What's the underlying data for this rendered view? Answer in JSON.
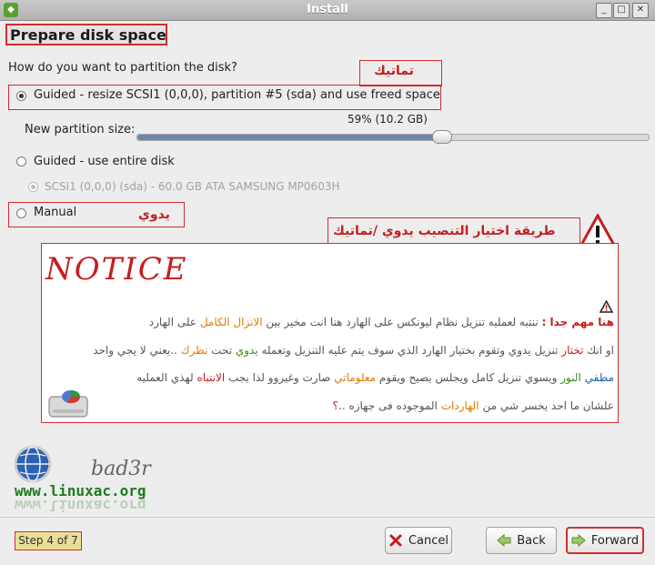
{
  "window": {
    "title": "Install"
  },
  "header": {
    "title": "Prepare disk space"
  },
  "question": "How do you want to partition the disk?",
  "annotations": {
    "guided_label": "تماتيك",
    "manual_label": "يدوي",
    "method_header": "طريقة اختيار التنصيب يدوي /تماتيك"
  },
  "options": {
    "guided_resize": "Guided - resize SCSI1 (0,0,0), partition #5 (sda) and use freed space",
    "new_partition_size_label": "New partition size:",
    "new_partition_size_value": "59% (10.2 GB)",
    "new_partition_size_fraction": 0.59,
    "guided_entire": "Guided - use entire disk",
    "disk_choice": "SCSI1 (0,0,0) (sda) - 60.0 GB ATA SAMSUNG MP0603H",
    "manual": "Manual"
  },
  "notice": {
    "title": "NOTICE",
    "line1_a": "هنا مهم جدا :",
    "line1_b": " ننتبه لعمليه تنزيل نظام ليونكس على الهارد  هنا انت مخير بين ",
    "line1_c": "الانزال الكامل",
    "line1_d": " على الهارد",
    "line2_a": "او انك ",
    "line2_b": "تختار",
    "line2_c": " تنزيل يدوي وتقوم بختيار الهارد الذي سوف يتم عليه التنزيل وتعمله ",
    "line2_d": "يدوي",
    "line2_e": " تحت ",
    "line2_f": "نظرك",
    "line2_g": " ..يعني لا يجي واحد",
    "line3_a": "مطفي ",
    "line3_b": "النور",
    "line3_c": " ويسوي تنزيل كامل ويجلس يصيح ويقوم ",
    "line3_d": "معلوماتي",
    "line3_e": " صارت وغيروو لذا يجب ",
    "line3_f": "الانتباه",
    "line3_g": " لهذي العمليه",
    "line4_a": "علشان ما احد يخسر شي من ",
    "line4_b": "الهاردات",
    "line4_c": " الموجوده فى جهازه ..",
    "line4_d": "؟"
  },
  "logo": {
    "name": "bad3r",
    "url": "www.linuxac.org"
  },
  "footer": {
    "step": "Step 4 of 7",
    "cancel": "Cancel",
    "back": "Back",
    "forward": "Forward"
  },
  "colors": {
    "accent_red": "#d32d2d",
    "slider_fill": "#6d87a8",
    "step_bg": "#e9df99"
  }
}
